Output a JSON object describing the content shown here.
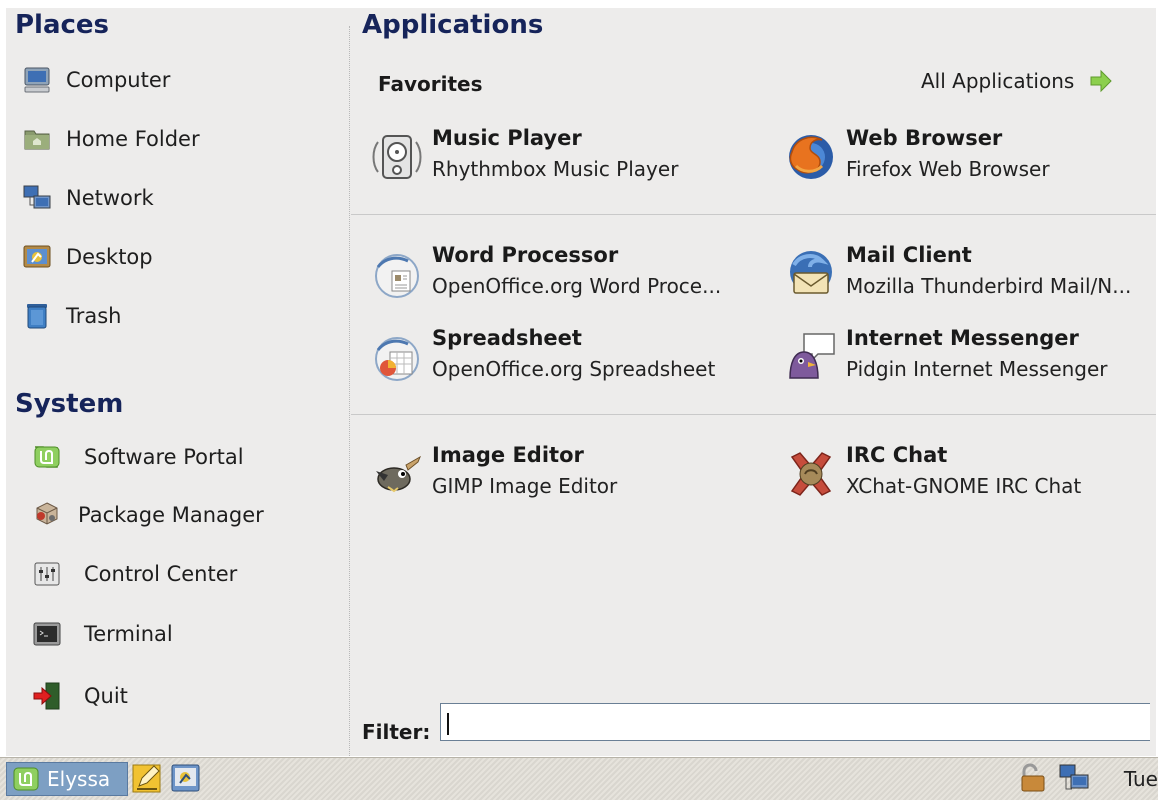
{
  "places": {
    "title": "Places",
    "items": [
      {
        "label": "Computer",
        "icon": "computer-icon"
      },
      {
        "label": "Home Folder",
        "icon": "home-folder-icon"
      },
      {
        "label": "Network",
        "icon": "network-icon"
      },
      {
        "label": "Desktop",
        "icon": "desktop-icon"
      },
      {
        "label": "Trash",
        "icon": "trash-icon"
      }
    ]
  },
  "system": {
    "title": "System",
    "items": [
      {
        "label": "Software Portal",
        "icon": "mint-logo-icon"
      },
      {
        "label": "Package Manager",
        "icon": "package-manager-icon"
      },
      {
        "label": "Control Center",
        "icon": "control-center-icon"
      },
      {
        "label": "Terminal",
        "icon": "terminal-icon"
      },
      {
        "label": "Quit",
        "icon": "quit-icon"
      }
    ]
  },
  "applications": {
    "title": "Applications",
    "favorites_label": "Favorites",
    "all_apps_label": "All Applications",
    "apps": [
      {
        "title": "Music Player",
        "desc": "Rhythmbox Music Player",
        "icon": "music-player-icon"
      },
      {
        "title": "Web Browser",
        "desc": "Firefox Web Browser",
        "icon": "firefox-icon"
      },
      {
        "title": "Word Processor",
        "desc": "OpenOffice.org Word Proce...",
        "icon": "word-processor-icon"
      },
      {
        "title": "Mail Client",
        "desc": "Mozilla Thunderbird Mail/N...",
        "icon": "thunderbird-icon"
      },
      {
        "title": "Spreadsheet",
        "desc": "OpenOffice.org Spreadsheet",
        "icon": "spreadsheet-icon"
      },
      {
        "title": "Internet Messenger",
        "desc": "Pidgin Internet Messenger",
        "icon": "pidgin-icon"
      },
      {
        "title": "Image Editor",
        "desc": "GIMP Image Editor",
        "icon": "gimp-icon"
      },
      {
        "title": "IRC Chat",
        "desc": "XChat-GNOME IRC Chat",
        "icon": "xchat-icon"
      }
    ]
  },
  "filter": {
    "label": "Filter:",
    "value": ""
  },
  "panel": {
    "menu_label": "Elyssa",
    "clock": "Tue",
    "launchers": [
      "text-editor-icon",
      "desktop-icon"
    ],
    "tray": [
      "update-lock-icon",
      "network-status-icon"
    ]
  },
  "colors": {
    "section_title": "#16245a",
    "menu_bg": "#edeceb",
    "menu_button": "#7d9fc3"
  }
}
